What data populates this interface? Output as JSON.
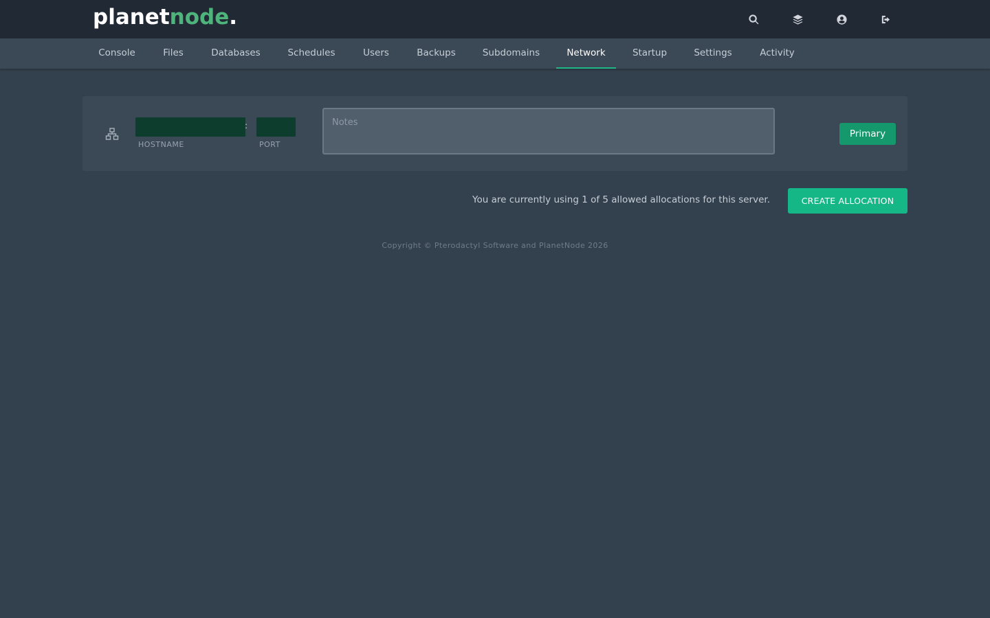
{
  "brand": {
    "name_main": "planet",
    "name_accent": "node",
    "name_dot": ".",
    "accent_color": "#4fb47b"
  },
  "top_icons": [
    "search-icon",
    "layers-icon",
    "user-circle-icon",
    "sign-out-icon"
  ],
  "nav": {
    "items": [
      {
        "label": "Console"
      },
      {
        "label": "Files"
      },
      {
        "label": "Databases"
      },
      {
        "label": "Schedules"
      },
      {
        "label": "Users"
      },
      {
        "label": "Backups"
      },
      {
        "label": "Subdomains"
      },
      {
        "label": "Network"
      },
      {
        "label": "Startup"
      },
      {
        "label": "Settings"
      },
      {
        "label": "Activity"
      }
    ],
    "active": "Network",
    "active_color": "#1fb786"
  },
  "allocation": {
    "hostname_label": "HOSTNAME",
    "port_label": "PORT",
    "separator": ":",
    "notes_placeholder": "Notes",
    "notes_value": "",
    "primary_label": "Primary"
  },
  "usage": {
    "text": "You are currently using 1 of 5 allowed allocations for this server.",
    "create_label": "CREATE ALLOCATION"
  },
  "footer": {
    "text": "Copyright © Pterodactyl Software and PlanetNode 2026"
  }
}
